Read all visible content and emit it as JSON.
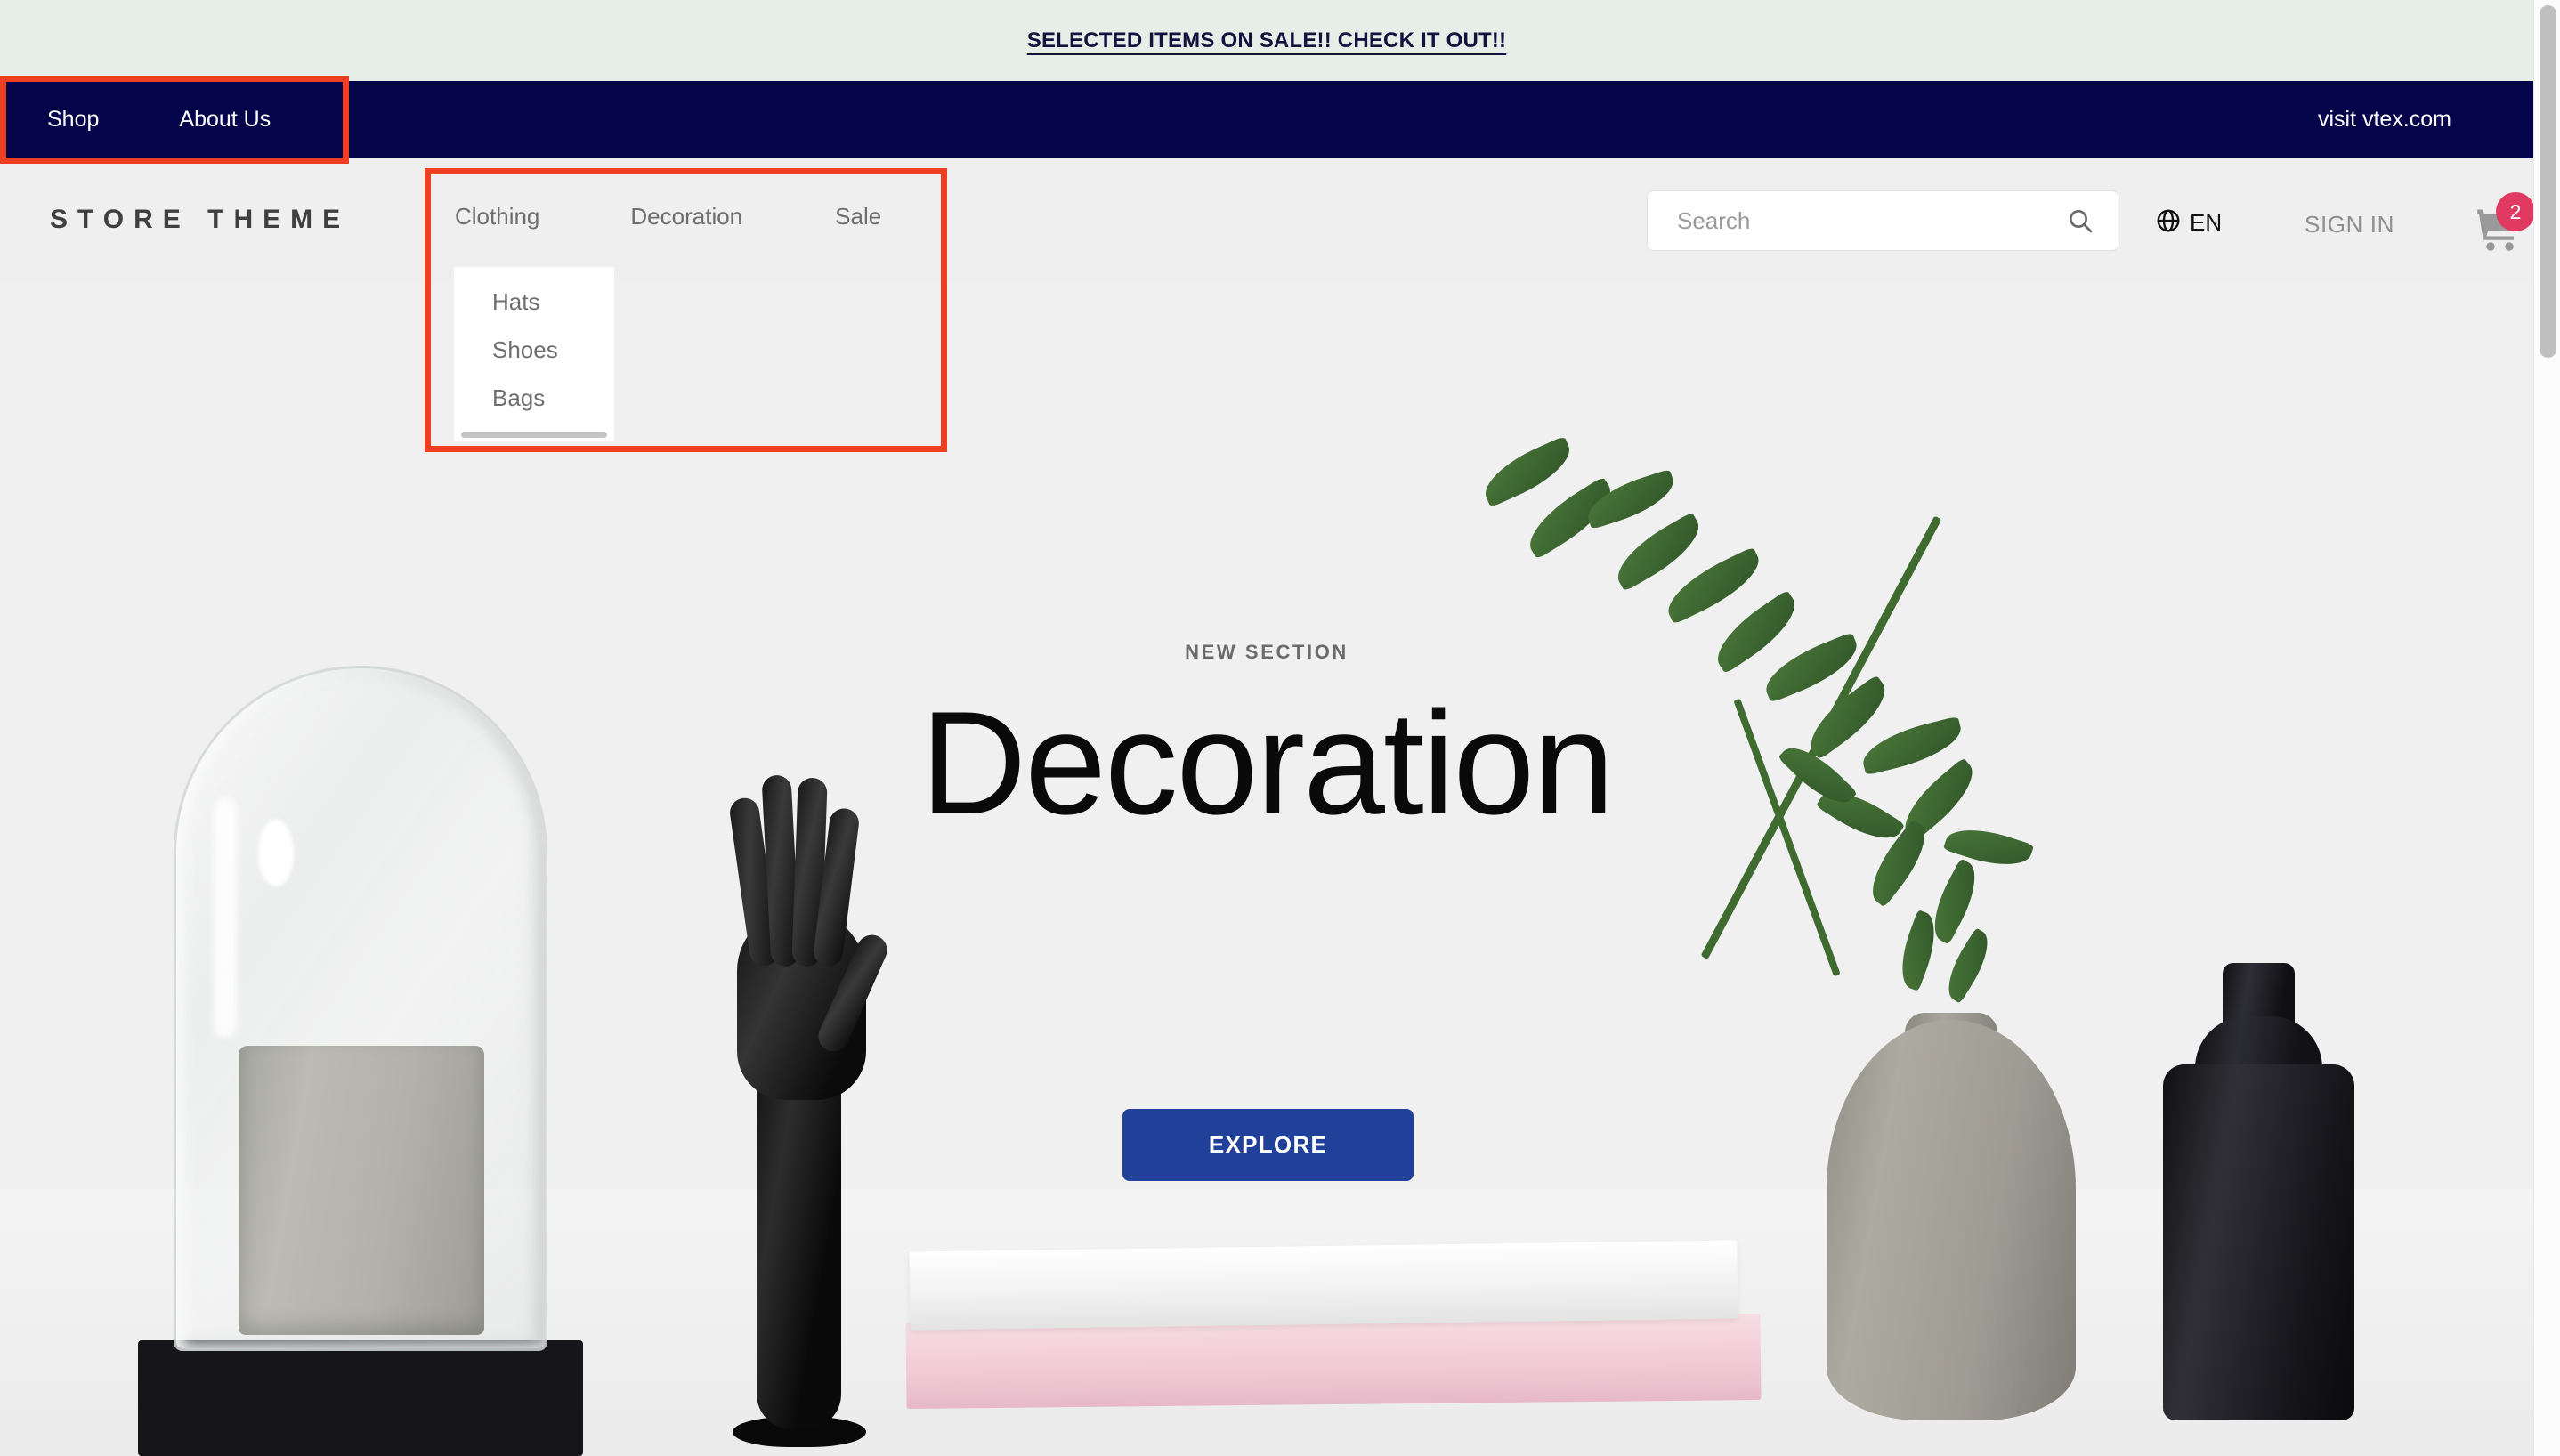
{
  "announcement": {
    "text": "SELECTED ITEMS ON SALE!! CHECK IT OUT!!",
    "bg_color": "#e5efe7",
    "text_color": "#13133f"
  },
  "topnav": {
    "bg_color": "#030449",
    "links": [
      {
        "label": "Shop"
      },
      {
        "label": "About Us"
      }
    ],
    "right_link": "visit vtex.com"
  },
  "header": {
    "logo": "STORE THEME",
    "categories": [
      {
        "label": "Clothing"
      },
      {
        "label": "Decoration"
      },
      {
        "label": "Sale"
      }
    ],
    "dropdown": {
      "parent": "Clothing",
      "items": [
        {
          "label": "Hats"
        },
        {
          "label": "Shoes"
        },
        {
          "label": "Bags"
        }
      ]
    },
    "search": {
      "placeholder": "Search",
      "value": "",
      "icon": "search-icon"
    },
    "locale": {
      "icon": "globe-icon",
      "label": "EN"
    },
    "signin_label": "SIGN IN",
    "cart": {
      "icon": "shopping-cart-icon",
      "badge_count": "2",
      "badge_color": "#e03a62"
    }
  },
  "hero": {
    "eyebrow": "NEW SECTION",
    "title": "Decoration",
    "cta_label": "EXPLORE",
    "cta_color": "#21409a"
  },
  "highlights": {
    "color": "#ef3f22",
    "boxes": [
      {
        "name": "topnav-links-highlight"
      },
      {
        "name": "category-nav-highlight"
      }
    ]
  },
  "scrollbar": {
    "thumb_color": "#bfbfbf"
  }
}
